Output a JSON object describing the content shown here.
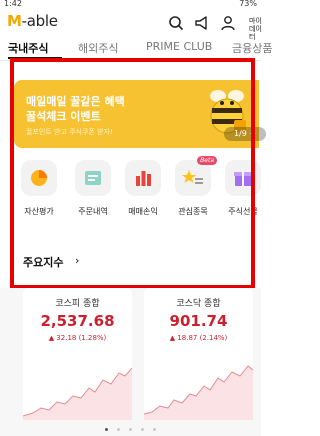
{
  "status": {
    "time": "1:42",
    "battery": "73%"
  },
  "header": {
    "logo_m": "M",
    "logo_rest": "-able",
    "menu_label": "마이 데이터"
  },
  "tabs": [
    {
      "label": "국내주식",
      "active": true
    },
    {
      "label": "해외주식",
      "active": false
    },
    {
      "label": "PRIME CLUB",
      "active": false
    },
    {
      "label": "금융상품",
      "active": false
    }
  ],
  "banner": {
    "line1": "매일매일 꿀같은 혜택",
    "line2": "꿀석체크 이벤트",
    "line3": "꿀포인트 받고 주식쿠폰 받자!",
    "pager": "1/9  +"
  },
  "quick_menu": [
    {
      "label": "자산평가",
      "icon": "pie-chart-icon"
    },
    {
      "label": "주문내역",
      "icon": "receipt-icon"
    },
    {
      "label": "매매손익",
      "icon": "bar-chart-icon"
    },
    {
      "label": "관심종목",
      "icon": "star-list-icon",
      "badge": "Beta"
    },
    {
      "label": "주식선물",
      "icon": "gift-icon"
    }
  ],
  "indices_section": {
    "title": "주요지수",
    "arrow": "›"
  },
  "indices": [
    {
      "name": "코스피 종합",
      "value": "2,537.68",
      "change": "▲ 32.18 (1.28%)"
    },
    {
      "name": "코스닥 종합",
      "value": "901.74",
      "change": "▲ 18.87 (2.14%)"
    }
  ],
  "pager_dots": 5,
  "colors": {
    "brand": "#f5a900",
    "banner": "#f6c232",
    "up": "#cc1f2e",
    "highlight": "#e60000"
  }
}
